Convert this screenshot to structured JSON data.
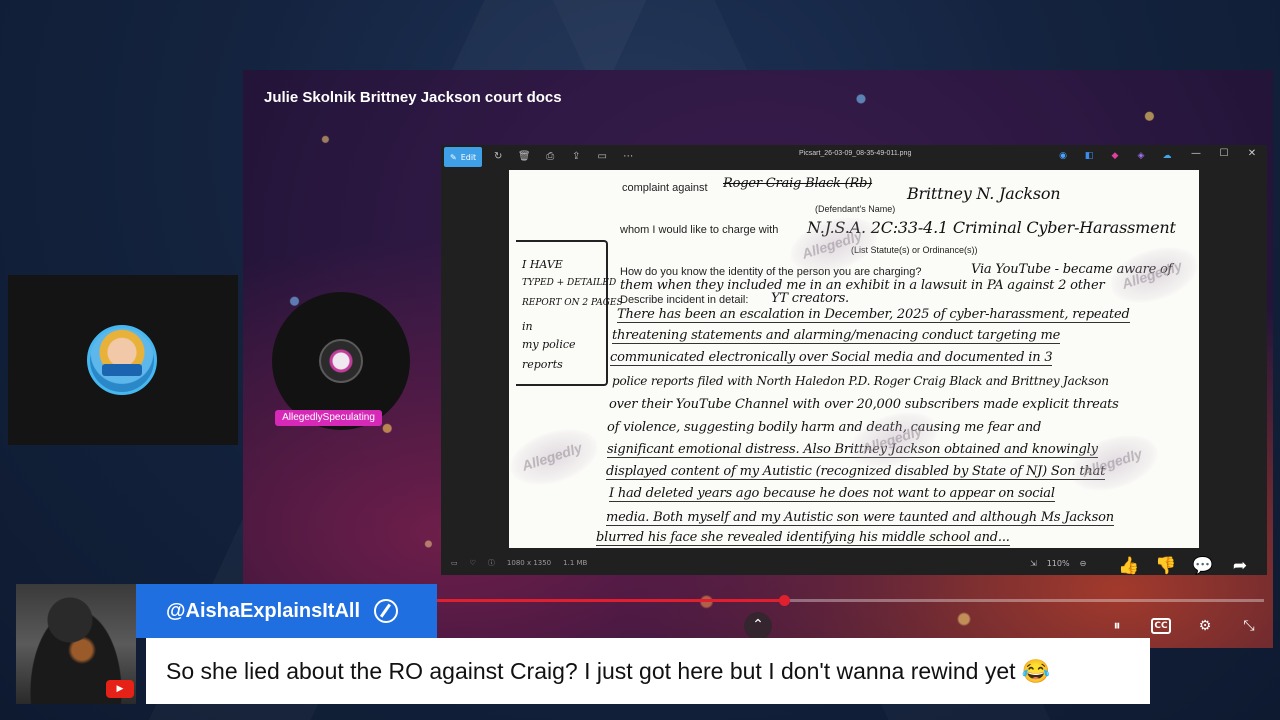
{
  "stage": {
    "title": "Julie Skolnik Brittney Jackson court docs"
  },
  "host": {
    "name": "AllegedlySpeculating"
  },
  "viewer": {
    "filename": "Picsart_26-03-09_08-35-49-011.png",
    "edit_label": "Edit",
    "status_dimensions": "1080 x 1350",
    "status_size": "1.1 MB",
    "zoom": "110%"
  },
  "document": {
    "l1_typed": "complaint against",
    "l1_strike": "Roger Craig Black (Rb)",
    "l1_hand": "Brittney N. Jackson",
    "l1_cap": "(Defendant's Name)",
    "l2_typed": "whom I would like to charge with",
    "l2_hand": "N.J.S.A. 2C:33-4.1   Criminal Cyber-Harassment",
    "l2_cap": "(List Statute(s) or Ordinance(s))",
    "l3_typed": "How do you know the identity of the person you are charging?",
    "l3_hand": "Via YouTube - became aware of",
    "l4_hand": "them when they included me in an exhibit in a lawsuit in PA against 2 other",
    "l5_typed": "Describe incident in detail:",
    "l5_hand": "YT creators.",
    "body": [
      "There has been an escalation in December, 2025 of cyber-harassment, repeated",
      "threatening statements and alarming/menacing conduct targeting me",
      "communicated electronically over Social media and documented in 3",
      "police reports filed with North Haledon P.D.  Roger Craig Black and Brittney Jackson",
      "over their YouTube Channel with over 20,000 subscribers made explicit threats",
      "of violence, suggesting bodily harm and death, causing me fear and",
      "significant emotional distress. Also Brittney Jackson obtained and knowingly",
      "displayed content of my Autistic (recognized disabled by State of NJ) Son that",
      "I had deleted years ago because he does not want to appear on social",
      "media. Both myself and my Autistic son were taunted and although Ms Jackson",
      "blurred his face she revealed identifying his middle school and..."
    ],
    "margin_note": [
      "I HAVE",
      "TYPED + DETAILED",
      "REPORT ON 2 PAGES",
      "in",
      "my police",
      "reports"
    ],
    "watermark": "Allegedly"
  },
  "commenter": {
    "handle": "@AishaExplainsItAll",
    "comment": "So she lied about the RO against Craig? I just got here but I don't wanna rewind yet 😂"
  },
  "player": {
    "progress": 0.42
  },
  "icons": {
    "thumbs_up": "thumbs-up-icon",
    "thumbs_down": "thumbs-down-icon",
    "comment": "comment-icon",
    "share": "share-icon",
    "pause": "pause-icon",
    "cc": "CC",
    "settings": "gear-icon",
    "collapse": "collapse-icon",
    "chevron_up": "chevron-up-icon",
    "youtube": "youtube-icon"
  },
  "colors": {
    "accent_blue": "#1f6fe0",
    "progress_red": "#e0202e",
    "host_badge": "#d629b8"
  }
}
